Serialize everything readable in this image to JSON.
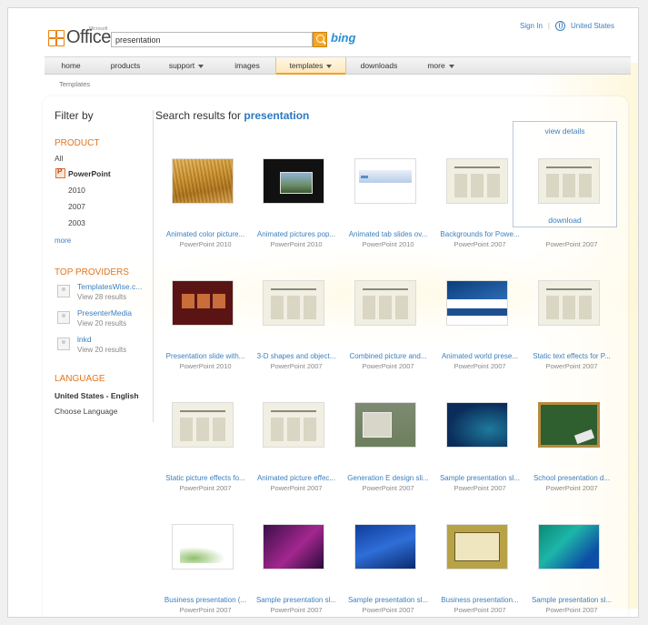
{
  "header": {
    "logo_text": "Office",
    "logo_small": "Microsoft",
    "search_value": "presentation",
    "bing_label": "bing",
    "sign_in": "Sign In",
    "region": "United States"
  },
  "nav": {
    "items": [
      {
        "label": "home"
      },
      {
        "label": "products"
      },
      {
        "label": "support"
      },
      {
        "label": "images"
      },
      {
        "label": "templates"
      },
      {
        "label": "downloads"
      },
      {
        "label": "more"
      }
    ]
  },
  "breadcrumb": "Templates",
  "sidebar": {
    "filter_title": "Filter by",
    "product_heading": "PRODUCT",
    "all": "All",
    "powerpoint": "PowerPoint",
    "versions": [
      "2010",
      "2007",
      "2003"
    ],
    "more": "more",
    "providers_heading": "TOP PROVIDERS",
    "providers": [
      {
        "name": "TemplatesWise.c...",
        "count": "View 28 results"
      },
      {
        "name": "PresenterMedia",
        "count": "View 20 results"
      },
      {
        "name": "lnkd",
        "count": "View 20 results"
      }
    ],
    "language_heading": "LANGUAGE",
    "language_selected": "United States - English",
    "choose_language": "Choose Language"
  },
  "results": {
    "prefix": "Search results for ",
    "query": "presentation",
    "hover_view": "view details",
    "hover_download": "download",
    "items": [
      {
        "title": "Animated color picture...",
        "ver": "PowerPoint 2010",
        "thumb": "wheat-thumbnail"
      },
      {
        "title": "Animated pictures pop...",
        "ver": "PowerPoint 2010",
        "thumb": "dark-thumbnail"
      },
      {
        "title": "Animated tab slides ov...",
        "ver": "PowerPoint 2010",
        "thumb": "tabs-thumbnail"
      },
      {
        "title": "Backgrounds for Powe...",
        "ver": "PowerPoint 2007",
        "thumb": "doc-thumbnail"
      },
      {
        "title": "",
        "ver": "PowerPoint 2007",
        "thumb": "doc-thumbnail"
      },
      {
        "title": "Presentation slide with...",
        "ver": "PowerPoint 2010",
        "thumb": "maroon-thumbnail"
      },
      {
        "title": "3-D shapes and object...",
        "ver": "PowerPoint 2007",
        "thumb": "doc-thumbnail"
      },
      {
        "title": "Combined picture and...",
        "ver": "PowerPoint 2007",
        "thumb": "doc-thumbnail"
      },
      {
        "title": "Animated world prese...",
        "ver": "PowerPoint 2007",
        "thumb": "bluewave-thumbnail"
      },
      {
        "title": "Static text effects for P...",
        "ver": "PowerPoint 2007",
        "thumb": "doc-thumbnail"
      },
      {
        "title": "Static picture effects fo...",
        "ver": "PowerPoint 2007",
        "thumb": "doc-thumbnail"
      },
      {
        "title": "Animated picture effec...",
        "ver": "PowerPoint 2007",
        "thumb": "doc-thumbnail"
      },
      {
        "title": "Generation E design sli...",
        "ver": "PowerPoint 2007",
        "thumb": "classroom-thumbnail"
      },
      {
        "title": "Sample presentation sl...",
        "ver": "PowerPoint 2007",
        "thumb": "teal-thumbnail"
      },
      {
        "title": "School presentation d...",
        "ver": "PowerPoint 2007",
        "thumb": "chalkboard-thumbnail"
      },
      {
        "title": "Business presentation (...",
        "ver": "PowerPoint 2007",
        "thumb": "green-thumbnail"
      },
      {
        "title": "Sample presentation sl...",
        "ver": "PowerPoint 2007",
        "thumb": "purple-thumbnail"
      },
      {
        "title": "Sample presentation sl...",
        "ver": "PowerPoint 2007",
        "thumb": "blue-thumbnail"
      },
      {
        "title": "Business presentation...",
        "ver": "PowerPoint 2007",
        "thumb": "gold-thumbnail"
      },
      {
        "title": "Sample presentation sl...",
        "ver": "PowerPoint 2007",
        "thumb": "aqua-thumbnail"
      }
    ]
  },
  "colors": {
    "accent_orange": "#e0751f",
    "link_blue": "#3c7fbf",
    "query_blue": "#2a79c2"
  }
}
